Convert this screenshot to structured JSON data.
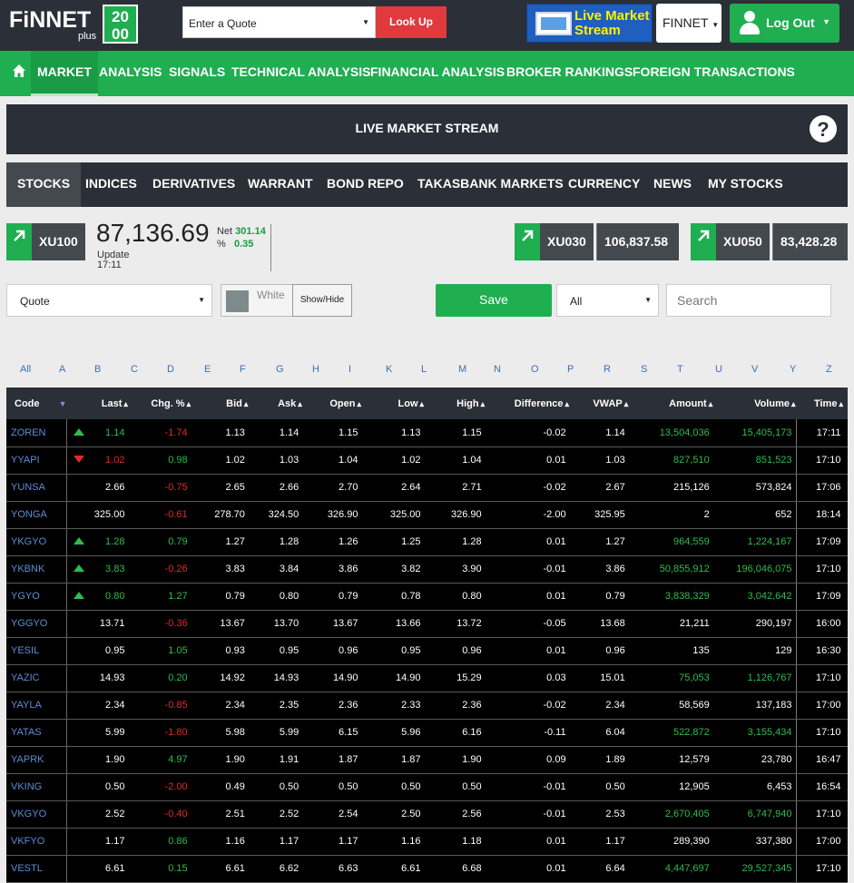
{
  "header": {
    "logo_text": "FiNNET",
    "logo_plus": "plus",
    "logo_badge_top": "20",
    "logo_badge_bottom": "00",
    "quote_placeholder": "Enter a Quote",
    "lookup_label": "Look Up",
    "live_stream_line1": "Live Market",
    "live_stream_line2": "Stream",
    "finnet_dropdown": "FINNET",
    "logout_label": "Log Out"
  },
  "nav": {
    "items": [
      "MARKET",
      "ANALYSIS",
      "SIGNALS",
      "TECHNICAL ANALYSIS",
      "FINANCIAL ANALYSIS",
      "BROKER RANKINGS",
      "FOREIGN TRANSACTIONS"
    ]
  },
  "banner": {
    "title": "LIVE MARKET STREAM",
    "help": "?"
  },
  "tabs": [
    "STOCKS",
    "INDICES",
    "DERIVATIVES",
    "WARRANT",
    "BOND REPO",
    "TAKASBANK MARKETS",
    "CURRENCY",
    "NEWS",
    "MY STOCKS"
  ],
  "indices": {
    "xu100": {
      "name": "XU100",
      "value": "87,136.69",
      "update_label": "Update",
      "update_time": "17:11",
      "net_label": "Net",
      "net_value": "301.14",
      "pct_label": "%",
      "pct_value": "0.35"
    },
    "xu030": {
      "name": "XU030",
      "value": "106,837.58"
    },
    "xu050": {
      "name": "XU050",
      "value": "83,428.28"
    }
  },
  "controls": {
    "view_select": "Quote",
    "color_label": "White",
    "color_swatch": "#7f8a8c",
    "showhide_label": "Show/Hide",
    "save_label": "Save",
    "filter_select": "All",
    "search_placeholder": "Search"
  },
  "alphabet": [
    "All",
    "A",
    "B",
    "C",
    "D",
    "E",
    "F",
    "G",
    "H",
    "I",
    "K",
    "L",
    "M",
    "N",
    "O",
    "P",
    "R",
    "S",
    "T",
    "U",
    "V",
    "Y",
    "Z"
  ],
  "table": {
    "columns": [
      "Code",
      "Last",
      "Chg. %",
      "Bid",
      "Ask",
      "Open",
      "Low",
      "High",
      "Difference",
      "VWAP",
      "Amount",
      "Volume",
      "Time"
    ],
    "rows": [
      {
        "code": "ZOREN",
        "dir": "up",
        "last": "1.14",
        "chg": "-1.74",
        "bid": "1.13",
        "ask": "1.14",
        "open": "1.15",
        "low": "1.13",
        "high": "1.15",
        "diff": "-0.02",
        "vwap": "1.14",
        "amount": "13,504,036",
        "volume": "15,405,173",
        "time": "17:11",
        "last_c": "up",
        "chg_c": "dn",
        "amt_c": "up"
      },
      {
        "code": "YYAPI",
        "dir": "dn",
        "last": "1.02",
        "chg": "0.98",
        "bid": "1.02",
        "ask": "1.03",
        "open": "1.04",
        "low": "1.02",
        "high": "1.04",
        "diff": "0.01",
        "vwap": "1.03",
        "amount": "827,510",
        "volume": "851,523",
        "time": "17:10",
        "last_c": "dn",
        "chg_c": "up",
        "amt_c": "up"
      },
      {
        "code": "YUNSA",
        "dir": "",
        "last": "2.66",
        "chg": "-0.75",
        "bid": "2.65",
        "ask": "2.66",
        "open": "2.70",
        "low": "2.64",
        "high": "2.71",
        "diff": "-0.02",
        "vwap": "2.67",
        "amount": "215,126",
        "volume": "573,824",
        "time": "17:06",
        "last_c": "",
        "chg_c": "dn",
        "amt_c": ""
      },
      {
        "code": "YONGA",
        "dir": "",
        "last": "325.00",
        "chg": "-0.61",
        "bid": "278.70",
        "ask": "324.50",
        "open": "326.90",
        "low": "325.00",
        "high": "326.90",
        "diff": "-2.00",
        "vwap": "325.95",
        "amount": "2",
        "volume": "652",
        "time": "18:14",
        "last_c": "",
        "chg_c": "dn",
        "amt_c": ""
      },
      {
        "code": "YKGYO",
        "dir": "up",
        "last": "1.28",
        "chg": "0.79",
        "bid": "1.27",
        "ask": "1.28",
        "open": "1.26",
        "low": "1.25",
        "high": "1.28",
        "diff": "0.01",
        "vwap": "1.27",
        "amount": "964,559",
        "volume": "1,224,167",
        "time": "17:09",
        "last_c": "up",
        "chg_c": "up",
        "amt_c": "up"
      },
      {
        "code": "YKBNK",
        "dir": "up",
        "last": "3.83",
        "chg": "-0.26",
        "bid": "3.83",
        "ask": "3.84",
        "open": "3.86",
        "low": "3.82",
        "high": "3.90",
        "diff": "-0.01",
        "vwap": "3.86",
        "amount": "50,855,912",
        "volume": "196,046,075",
        "time": "17:10",
        "last_c": "up",
        "chg_c": "dn",
        "amt_c": "up"
      },
      {
        "code": "YGYO",
        "dir": "up",
        "last": "0.80",
        "chg": "1.27",
        "bid": "0.79",
        "ask": "0.80",
        "open": "0.79",
        "low": "0.78",
        "high": "0.80",
        "diff": "0.01",
        "vwap": "0.79",
        "amount": "3,838,329",
        "volume": "3,042,642",
        "time": "17:09",
        "last_c": "up",
        "chg_c": "up",
        "amt_c": "up"
      },
      {
        "code": "YGGYO",
        "dir": "",
        "last": "13.71",
        "chg": "-0.36",
        "bid": "13.67",
        "ask": "13.70",
        "open": "13.67",
        "low": "13.66",
        "high": "13.72",
        "diff": "-0.05",
        "vwap": "13.68",
        "amount": "21,211",
        "volume": "290,197",
        "time": "16:00",
        "last_c": "",
        "chg_c": "dn",
        "amt_c": ""
      },
      {
        "code": "YESIL",
        "dir": "",
        "last": "0.95",
        "chg": "1.05",
        "bid": "0.93",
        "ask": "0.95",
        "open": "0.96",
        "low": "0.95",
        "high": "0.96",
        "diff": "0.01",
        "vwap": "0.96",
        "amount": "135",
        "volume": "129",
        "time": "16:30",
        "last_c": "",
        "chg_c": "up",
        "amt_c": ""
      },
      {
        "code": "YAZIC",
        "dir": "",
        "last": "14.93",
        "chg": "0.20",
        "bid": "14.92",
        "ask": "14.93",
        "open": "14.90",
        "low": "14.90",
        "high": "15.29",
        "diff": "0.03",
        "vwap": "15.01",
        "amount": "75,053",
        "volume": "1,126,767",
        "time": "17:10",
        "last_c": "",
        "chg_c": "up",
        "amt_c": "up"
      },
      {
        "code": "YAYLA",
        "dir": "",
        "last": "2.34",
        "chg": "-0.85",
        "bid": "2.34",
        "ask": "2.35",
        "open": "2.36",
        "low": "2.33",
        "high": "2.36",
        "diff": "-0.02",
        "vwap": "2.34",
        "amount": "58,569",
        "volume": "137,183",
        "time": "17:00",
        "last_c": "",
        "chg_c": "dn",
        "amt_c": ""
      },
      {
        "code": "YATAS",
        "dir": "",
        "last": "5.99",
        "chg": "-1.80",
        "bid": "5.98",
        "ask": "5.99",
        "open": "6.15",
        "low": "5.96",
        "high": "6.16",
        "diff": "-0.11",
        "vwap": "6.04",
        "amount": "522,872",
        "volume": "3,155,434",
        "time": "17:10",
        "last_c": "",
        "chg_c": "dn",
        "amt_c": "up"
      },
      {
        "code": "YAPRK",
        "dir": "",
        "last": "1.90",
        "chg": "4.97",
        "bid": "1.90",
        "ask": "1.91",
        "open": "1.87",
        "low": "1.87",
        "high": "1.90",
        "diff": "0.09",
        "vwap": "1.89",
        "amount": "12,579",
        "volume": "23,780",
        "time": "16:47",
        "last_c": "",
        "chg_c": "up",
        "amt_c": ""
      },
      {
        "code": "VKING",
        "dir": "",
        "last": "0.50",
        "chg": "-2.00",
        "bid": "0.49",
        "ask": "0.50",
        "open": "0.50",
        "low": "0.50",
        "high": "0.50",
        "diff": "-0.01",
        "vwap": "0.50",
        "amount": "12,905",
        "volume": "6,453",
        "time": "16:54",
        "last_c": "",
        "chg_c": "dn",
        "amt_c": ""
      },
      {
        "code": "VKGYO",
        "dir": "",
        "last": "2.52",
        "chg": "-0.40",
        "bid": "2.51",
        "ask": "2.52",
        "open": "2.54",
        "low": "2.50",
        "high": "2.56",
        "diff": "-0.01",
        "vwap": "2.53",
        "amount": "2,670,405",
        "volume": "6,747,940",
        "time": "17:10",
        "last_c": "",
        "chg_c": "dn",
        "amt_c": "up"
      },
      {
        "code": "VKFYO",
        "dir": "",
        "last": "1.17",
        "chg": "0.86",
        "bid": "1.16",
        "ask": "1.17",
        "open": "1.17",
        "low": "1.16",
        "high": "1.18",
        "diff": "0.01",
        "vwap": "1.17",
        "amount": "289,390",
        "volume": "337,380",
        "time": "17:00",
        "last_c": "",
        "chg_c": "up",
        "amt_c": ""
      },
      {
        "code": "VESTL",
        "dir": "",
        "last": "6.61",
        "chg": "0.15",
        "bid": "6.61",
        "ask": "6.62",
        "open": "6.63",
        "low": "6.61",
        "high": "6.68",
        "diff": "0.01",
        "vwap": "6.64",
        "amount": "4,447,697",
        "volume": "29,527,345",
        "time": "17:10",
        "last_c": "",
        "chg_c": "up",
        "amt_c": "up"
      }
    ]
  },
  "colors": {
    "green": "#1fae50",
    "dark": "#2b2f37",
    "red": "#e0393e",
    "blue": "#1e5fc0"
  }
}
